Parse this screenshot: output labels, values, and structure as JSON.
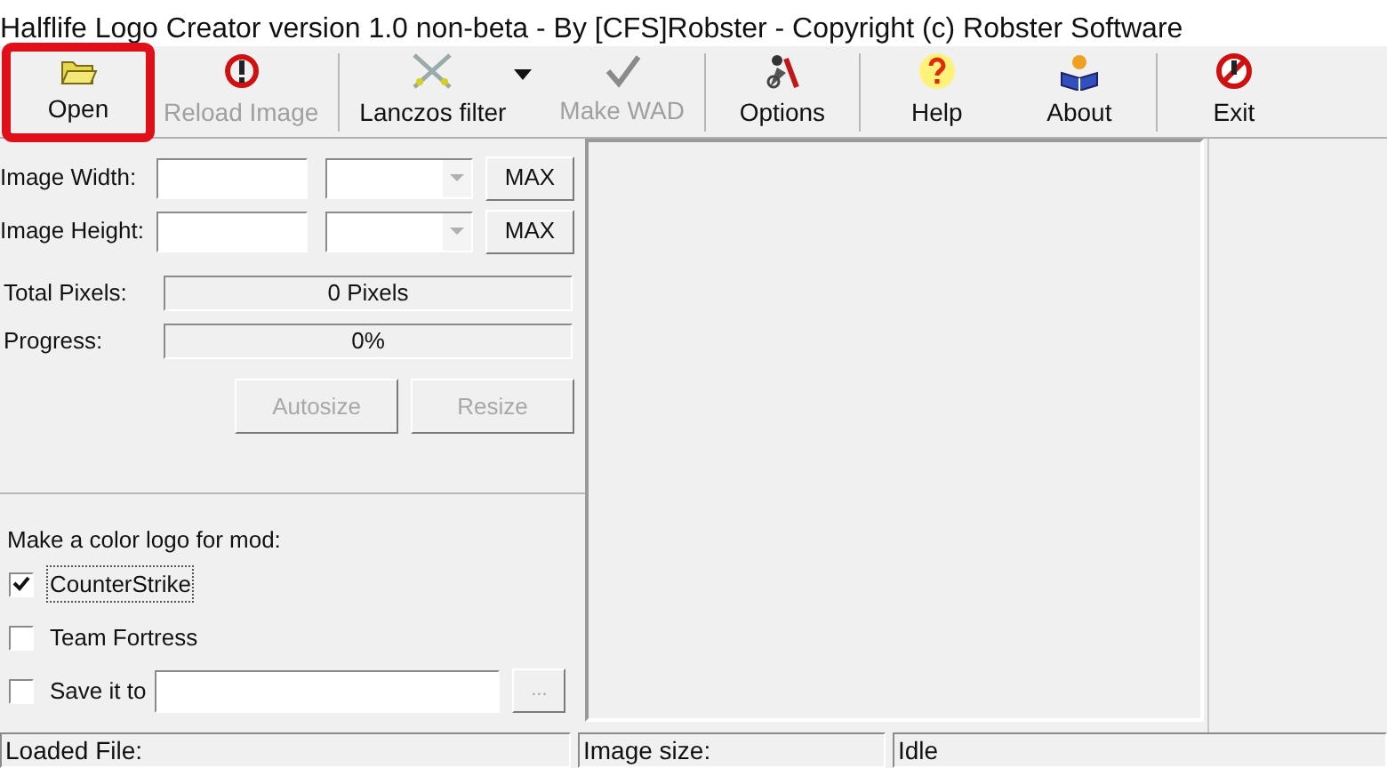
{
  "window": {
    "title": "Halflife Logo Creator version 1.0 non-beta - By [CFS]Robster - Copyright (c) Robster Software"
  },
  "toolbar": [
    {
      "label": "Open",
      "disabled": false,
      "highlighted": true,
      "has_menu": false,
      "separator_after": false
    },
    {
      "label": "Reload Image",
      "disabled": true,
      "highlighted": false,
      "has_menu": false,
      "separator_after": true
    },
    {
      "label": "Lanczos filter",
      "disabled": false,
      "highlighted": false,
      "has_menu": true,
      "separator_after": false
    },
    {
      "label": "Make WAD",
      "disabled": true,
      "highlighted": false,
      "has_menu": false,
      "separator_after": true
    },
    {
      "label": "Options",
      "disabled": false,
      "highlighted": false,
      "has_menu": false,
      "separator_after": true
    },
    {
      "label": "Help",
      "disabled": false,
      "highlighted": false,
      "has_menu": false,
      "separator_after": false
    },
    {
      "label": "About",
      "disabled": false,
      "highlighted": false,
      "has_menu": false,
      "separator_after": true
    },
    {
      "label": "Exit",
      "disabled": false,
      "highlighted": false,
      "has_menu": false,
      "separator_after": false
    }
  ],
  "size_rows": [
    {
      "label": "Image Width:",
      "button": "MAX"
    },
    {
      "label": "Image Height:",
      "button": "MAX"
    }
  ],
  "info_rows": [
    {
      "label": "Total Pixels:",
      "value": "0 Pixels"
    },
    {
      "label": "Progress:",
      "value": "0%"
    }
  ],
  "actions": [
    {
      "label": "Autosize",
      "disabled": true
    },
    {
      "label": "Resize",
      "disabled": true
    }
  ],
  "mod_group": {
    "heading": "Make a color logo for mod:",
    "options": [
      {
        "kind": "plain",
        "label": "CounterStrike",
        "checked": true,
        "focused": true
      },
      {
        "kind": "plain",
        "label": "Team Fortress",
        "checked": false,
        "focused": false
      },
      {
        "kind": "path",
        "label": "Save it to",
        "checked": false,
        "focused": false,
        "browse": "...",
        "browse_disabled": true
      }
    ]
  },
  "status_bar": [
    "Loaded File:",
    "Image size:",
    "Idle"
  ]
}
